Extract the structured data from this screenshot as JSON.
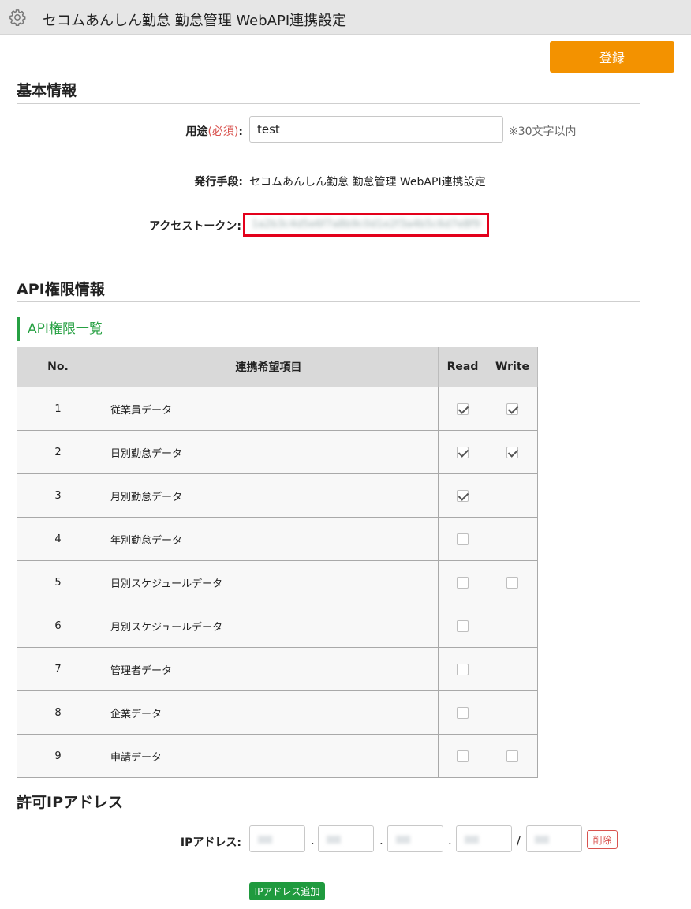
{
  "header": {
    "title": "セコムあんしん勤怠 勤怠管理 WebAPI連携設定",
    "icon": "gear-icon"
  },
  "toolbar": {
    "register_label": "登録"
  },
  "basic": {
    "section_title": "基本情報",
    "purpose_label": "用途",
    "required_mark": "(必須)",
    "label_colon": ":",
    "purpose_value": "test",
    "purpose_hint": "※30文字以内",
    "issuer_label": "発行手段:",
    "issuer_value": "セコムあんしん勤怠 勤怠管理 WebAPI連携設定",
    "token_label": "アクセストークン:",
    "token_value": "1a2b3c4d5e6f7a8b9c0d1e2f3a4b5c6d7e8f9"
  },
  "api": {
    "section_title": "API権限情報",
    "list_title": "API権限一覧",
    "columns": {
      "no": "No.",
      "item": "連携希望項目",
      "read": "Read",
      "write": "Write"
    },
    "rows": [
      {
        "no": "1",
        "name": "従業員データ",
        "read": true,
        "write": true
      },
      {
        "no": "2",
        "name": "日別勤怠データ",
        "read": true,
        "write": true
      },
      {
        "no": "3",
        "name": "月別勤怠データ",
        "read": true,
        "write": null
      },
      {
        "no": "4",
        "name": "年別勤怠データ",
        "read": false,
        "write": null
      },
      {
        "no": "5",
        "name": "日別スケジュールデータ",
        "read": false,
        "write": false
      },
      {
        "no": "6",
        "name": "月別スケジュールデータ",
        "read": false,
        "write": null
      },
      {
        "no": "7",
        "name": "管理者データ",
        "read": false,
        "write": null
      },
      {
        "no": "8",
        "name": "企業データ",
        "read": false,
        "write": null
      },
      {
        "no": "9",
        "name": "申請データ",
        "read": false,
        "write": false
      }
    ]
  },
  "ip": {
    "section_title": "許可IPアドレス",
    "label": "IPアドレス:",
    "dot": ".",
    "slash": "/",
    "delete_label": "削除",
    "add_label": "IPアドレス追加"
  },
  "colors": {
    "accent_orange": "#f39200",
    "accent_green": "#26a042",
    "required_red": "#d9534f",
    "highlight_red": "#e3001b"
  }
}
